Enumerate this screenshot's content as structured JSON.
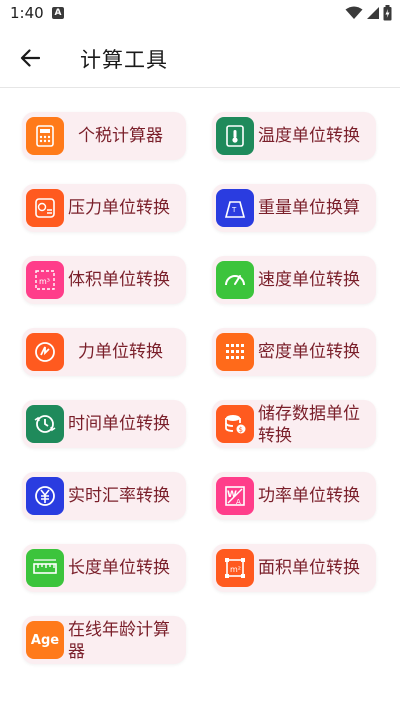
{
  "status_bar": {
    "time": "1:40",
    "notification_badge": "A"
  },
  "app_bar": {
    "title": "计算工具"
  },
  "tools": [
    {
      "label": "个税计算器",
      "icon": "tax-calculator-icon",
      "color": "#ff7a1a"
    },
    {
      "label": "温度单位转换",
      "icon": "thermometer-icon",
      "color": "#1f8a5b"
    },
    {
      "label": "压力单位转换",
      "icon": "pressure-gauge-icon",
      "color": "#ff5a1f"
    },
    {
      "label": "重量单位换算",
      "icon": "weight-icon",
      "color": "#2a3ce0"
    },
    {
      "label": "体积单位转换",
      "icon": "volume-cube-icon",
      "color": "#ff3d8a"
    },
    {
      "label": "速度单位转换",
      "icon": "speedometer-icon",
      "color": "#3cc43c"
    },
    {
      "label": "力单位转换",
      "icon": "force-icon",
      "color": "#ff5a1f"
    },
    {
      "label": "密度单位转换",
      "icon": "density-grid-icon",
      "color": "#ff6a1a"
    },
    {
      "label": "时间单位转换",
      "icon": "clock-convert-icon",
      "color": "#1f8a5b"
    },
    {
      "label": "储存数据单位转换",
      "icon": "database-icon",
      "color": "#ff5a1f"
    },
    {
      "label": "实时汇率转换",
      "icon": "currency-exchange-icon",
      "color": "#2a3ce0"
    },
    {
      "label": "功率单位转换",
      "icon": "power-icon",
      "color": "#ff3d8a"
    },
    {
      "label": "长度单位转换",
      "icon": "ruler-icon",
      "color": "#3cc43c"
    },
    {
      "label": "面积单位转换",
      "icon": "area-icon",
      "color": "#ff5a1f"
    },
    {
      "label": "在线年龄计算器",
      "icon": "age-icon",
      "icon_text": "Age",
      "color": "#ff7a1a"
    }
  ]
}
